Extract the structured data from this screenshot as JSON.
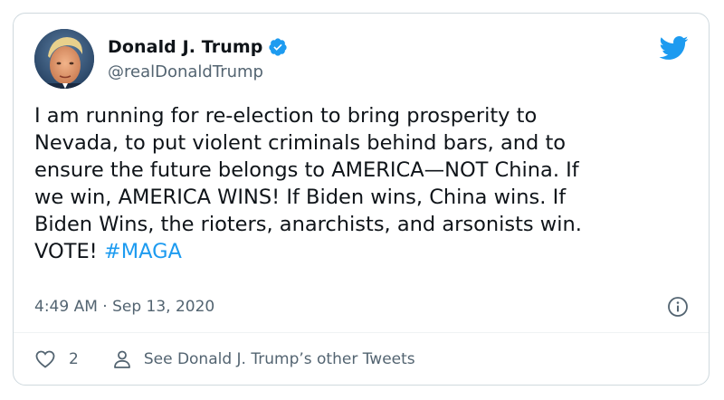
{
  "author": {
    "display_name": "Donald J. Trump",
    "handle": "@realDonaldTrump",
    "verified": true
  },
  "tweet": {
    "lines": [
      "I am running for re-election to bring prosperity to",
      "Nevada, to put violent criminals behind bars, and to",
      "ensure the future belongs to AMERICA—NOT China. If",
      "we win, AMERICA WINS! If Biden wins, China wins. If",
      "Biden Wins, the rioters, anarchists, and arsonists win."
    ],
    "last_line_prefix": "VOTE! ",
    "hashtag": "#MAGA",
    "timestamp": "4:49 AM · Sep 13, 2020"
  },
  "actions": {
    "like_count": "2",
    "other_tweets_label": "See Donald J. Trump’s other Tweets"
  },
  "icons": {
    "brand": "twitter-bird-icon",
    "verified": "verified-badge-icon",
    "info": "info-icon",
    "like": "heart-icon",
    "profile": "person-icon"
  },
  "colors": {
    "accent": "#1d9bf0",
    "text": "#0f1419",
    "secondary": "#536471",
    "border": "#cfd9de"
  }
}
